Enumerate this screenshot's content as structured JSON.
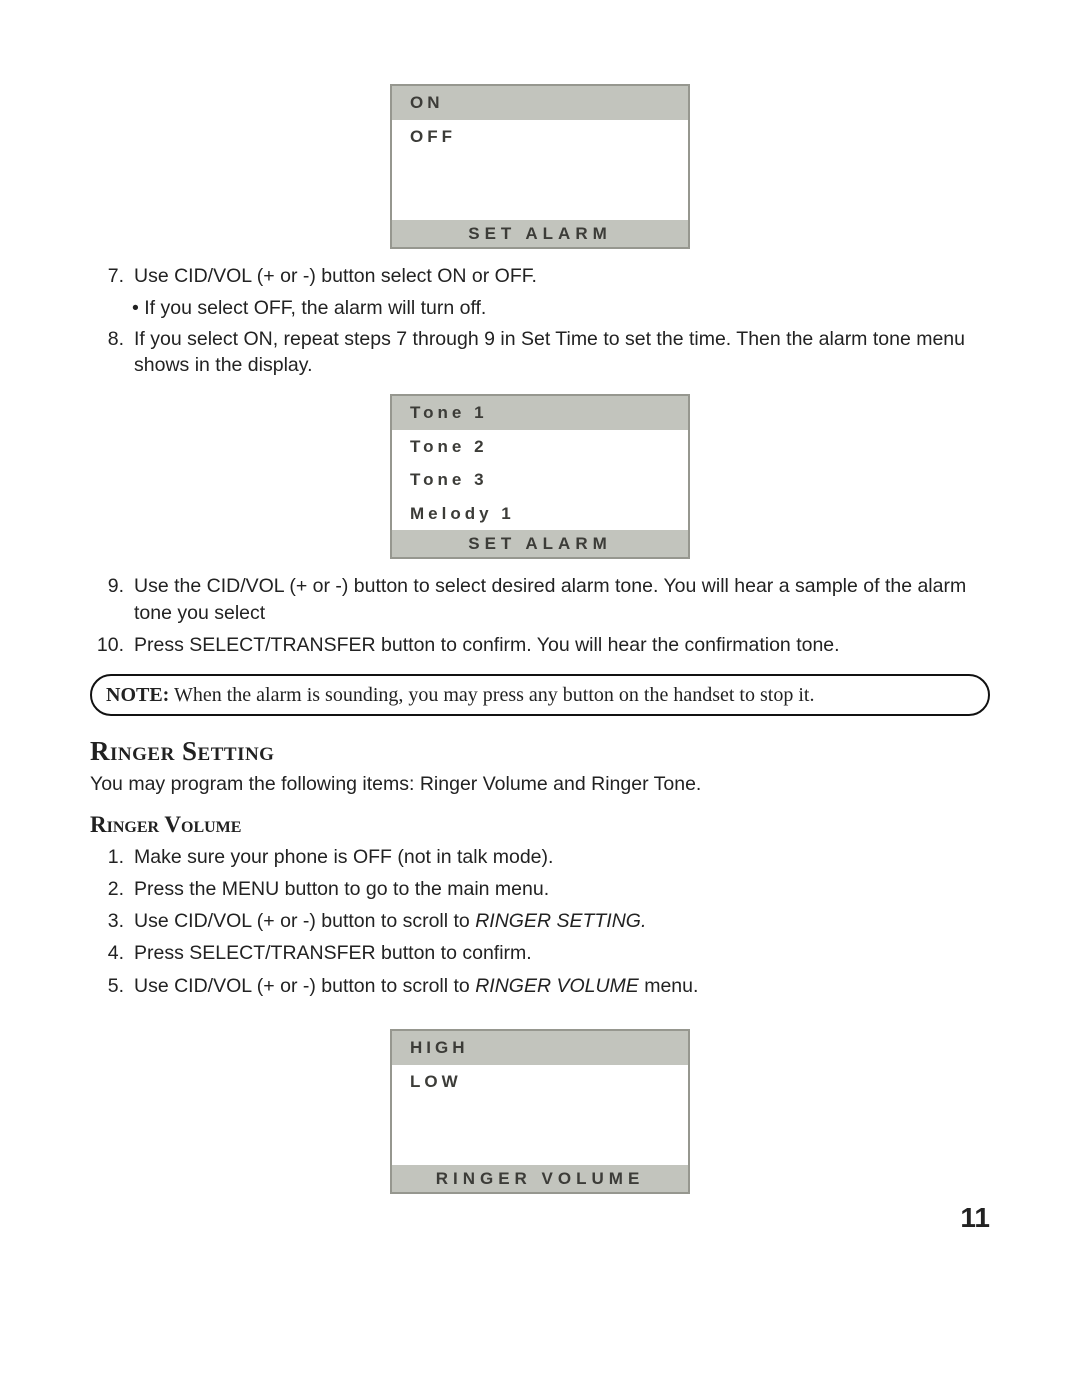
{
  "page_number": "11",
  "lcd_alarm_onoff": {
    "rows": [
      {
        "text": "ON",
        "selected": true
      },
      {
        "text": "OFF",
        "selected": false
      },
      {
        "text": "",
        "selected": false,
        "empty": true
      },
      {
        "text": "",
        "selected": false,
        "empty": true
      }
    ],
    "footer": "SET ALARM"
  },
  "lcd_alarm_tone": {
    "rows": [
      {
        "text": "Tone 1",
        "selected": true
      },
      {
        "text": "Tone 2",
        "selected": false
      },
      {
        "text": "Tone 3",
        "selected": false
      },
      {
        "text": "Melody 1",
        "selected": false
      }
    ],
    "footer": "SET ALARM"
  },
  "lcd_ringer_volume": {
    "rows": [
      {
        "text": "HIGH",
        "selected": true
      },
      {
        "text": "LOW",
        "selected": false
      },
      {
        "text": "",
        "selected": false,
        "empty": true
      },
      {
        "text": "",
        "selected": false,
        "empty": true
      }
    ],
    "footer": "RINGER VOLUME"
  },
  "steps_a": [
    {
      "num": "7.",
      "text": "Use CID/VOL (+ or -) button select ON or OFF."
    }
  ],
  "steps_a_sub": "If you select OFF, the alarm will turn off.",
  "steps_b": [
    {
      "num": "8.",
      "text": "If you select ON, repeat steps 7 through 9 in Set Time to set the time. Then the alarm tone menu shows in the display."
    }
  ],
  "steps_c": [
    {
      "num": "9.",
      "text": "Use the CID/VOL (+ or -) button to select desired alarm tone. You will hear a sample of the alarm tone you select"
    },
    {
      "num": "10.",
      "text": "Press SELECT/TRANSFER button to confirm. You will hear the confirmation tone."
    }
  ],
  "note_label": "NOTE:",
  "note_text": " When the alarm is sounding, you may press any button on the handset to stop it.",
  "heading_ringer_setting": "Ringer Setting",
  "ringer_setting_intro": "You may program the following items: Ringer Volume and Ringer Tone.",
  "heading_ringer_volume": "Ringer Volume",
  "ringer_volume_steps": [
    {
      "num": "1.",
      "text": "Make sure your phone is OFF (not in talk mode)."
    },
    {
      "num": "2.",
      "text": "Press the MENU button to go to the main menu."
    },
    {
      "num": "3.",
      "text_pre": "Use CID/VOL (+ or -) button to scroll to ",
      "em": "RINGER SETTING.",
      "text_post": ""
    },
    {
      "num": "4.",
      "text": "Press SELECT/TRANSFER button to confirm."
    },
    {
      "num": "5.",
      "text_pre": "Use CID/VOL (+ or -) button to scroll to ",
      "em": "RINGER VOLUME",
      "text_post": " menu."
    }
  ]
}
